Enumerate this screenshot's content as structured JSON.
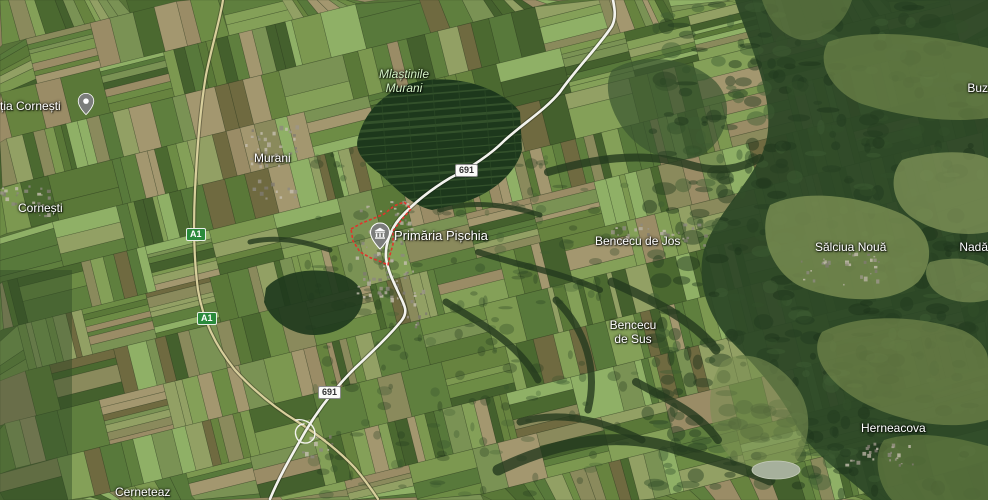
{
  "map": {
    "colors": {
      "road": "#f3f3ee",
      "motorway": "#d8cf9c",
      "boundary": "#e0342c",
      "motorway_shield": "#2a8a3c",
      "pin": "#7b7d7b",
      "label": "#ffffff",
      "water_label": "#d4f2c6"
    },
    "icons": {
      "pin": "place-pin-icon",
      "town_hall": "town-hall-icon"
    }
  },
  "pins": {
    "primaria_pischia": {
      "label": "Primăria Pișchia",
      "icon": "town-hall-icon"
    },
    "cornesti_station": {
      "label": "ția Cornești",
      "icon": "place-pin-icon"
    }
  },
  "places": {
    "mlastinile_murani": [
      "Mlaștinile",
      "Murani"
    ],
    "murani": "Murani",
    "cornesti": "Cornești",
    "bencecu_de_jos": "Bencecu de Jos",
    "bencecu_de_sus": [
      "Bencecu",
      "de Sus"
    ],
    "salciua_noua": "Sălciua Nouă",
    "nada": "Nadă",
    "buz": "Buz",
    "herneacova": "Herneacova",
    "cerneteaz": "Cerneteaz"
  },
  "roads": {
    "dn691": {
      "shield": "691"
    },
    "a1": {
      "shield": "A1"
    }
  }
}
